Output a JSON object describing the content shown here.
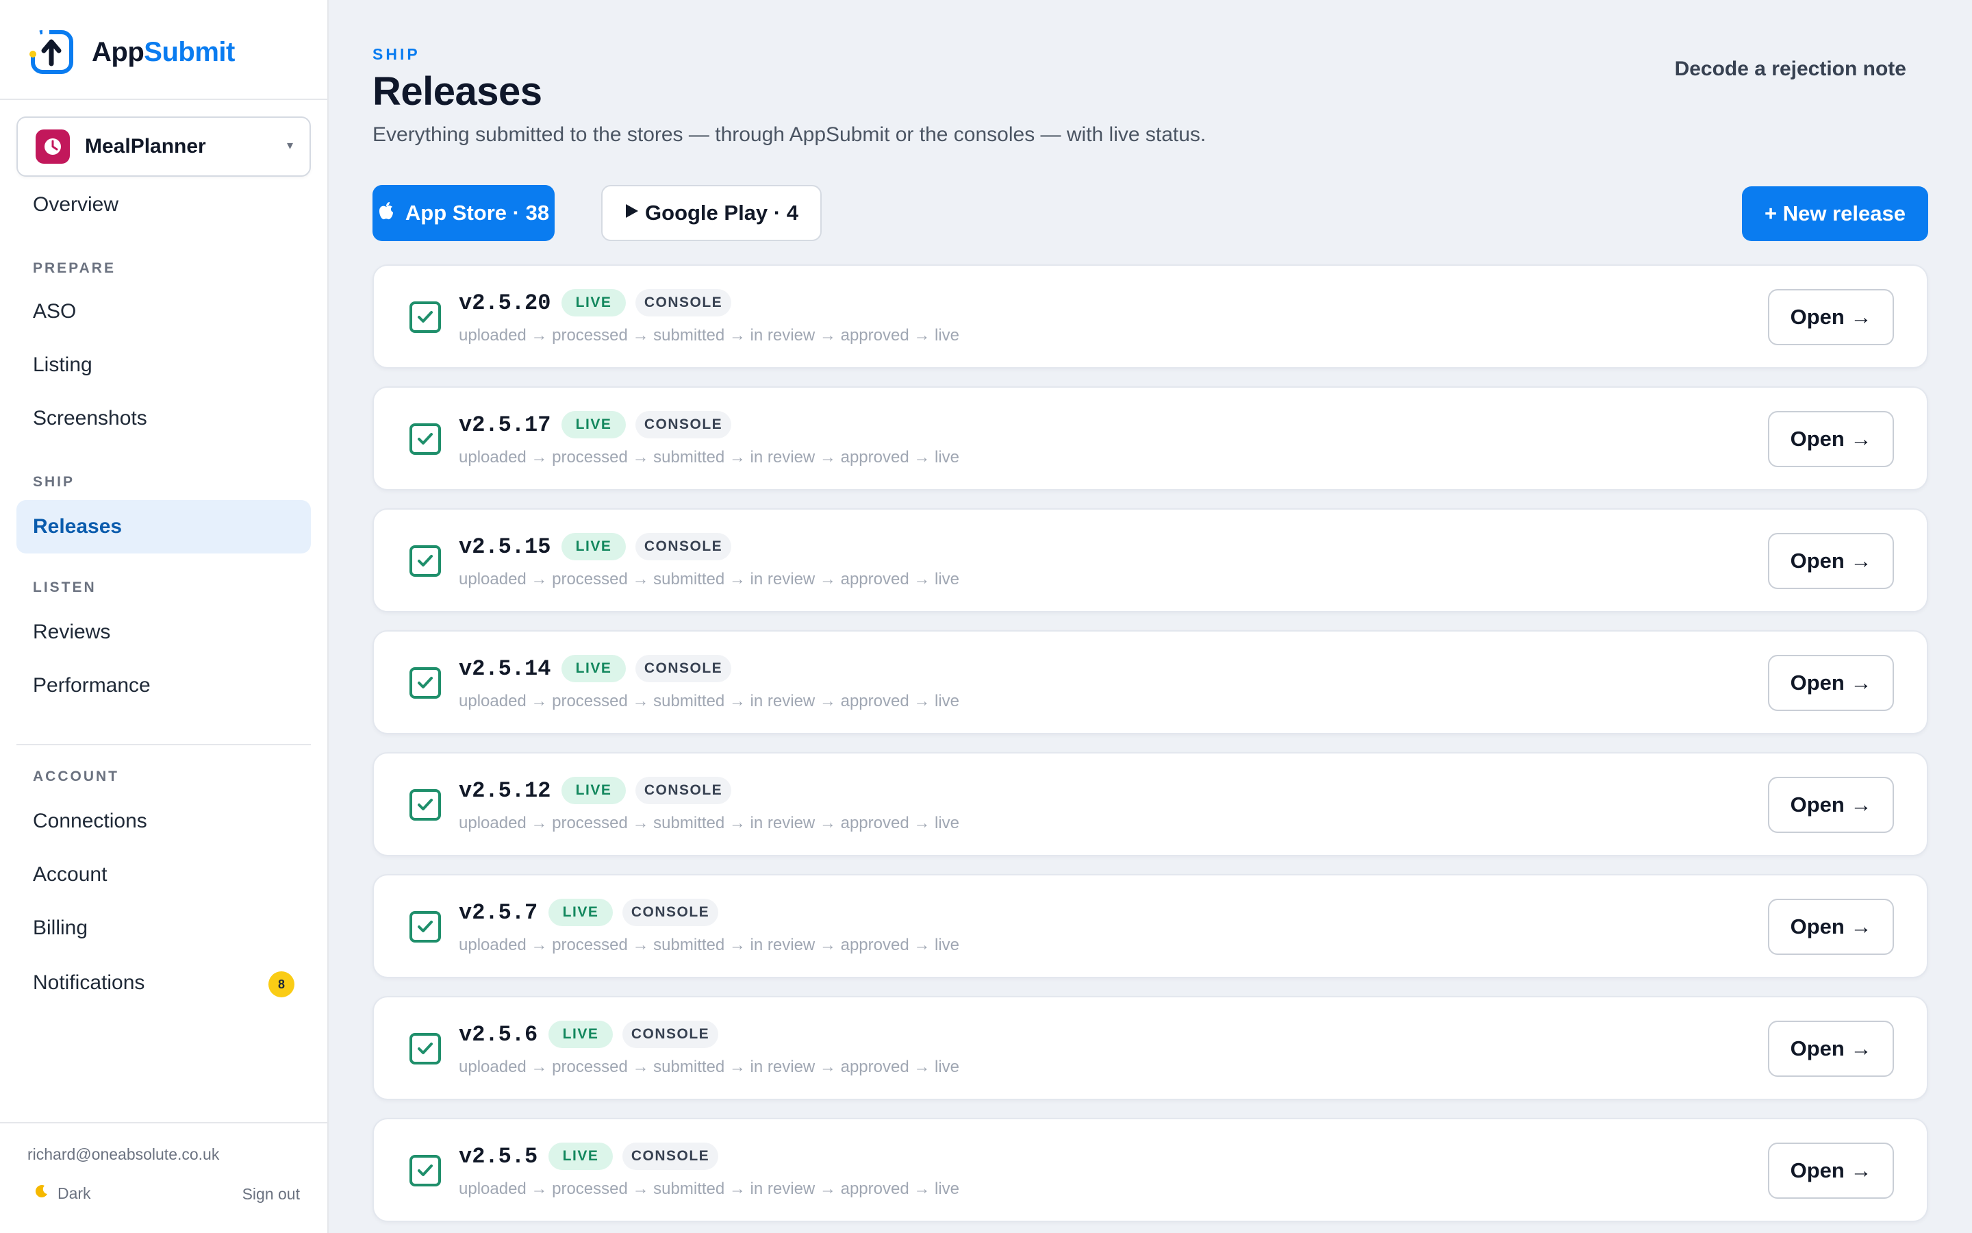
{
  "brand": {
    "name_part1": "App",
    "name_part2": "Submit"
  },
  "app_selector": {
    "name": "MealPlanner",
    "caret": "▾"
  },
  "nav": {
    "overview": "Overview",
    "sections": {
      "prepare": "PREPARE",
      "ship": "SHIP",
      "listen": "LISTEN",
      "account": "ACCOUNT"
    },
    "items": {
      "aso": "ASO",
      "listing": "Listing",
      "screenshots": "Screenshots",
      "releases": "Releases",
      "reviews": "Reviews",
      "performance": "Performance",
      "connections": "Connections",
      "account": "Account",
      "billing": "Billing",
      "notifications": "Notifications"
    },
    "notifications_count": "8"
  },
  "footer": {
    "email": "richard@oneabsolute.co.uk",
    "theme_label": "Dark",
    "sign_out": "Sign out"
  },
  "header": {
    "eyebrow": "SHIP",
    "title": "Releases",
    "subtitle": "Everything submitted to the stores — through AppSubmit or the consoles — with live status.",
    "decode_link": "Decode a rejection note"
  },
  "tabs": {
    "app_store": "App Store · 38",
    "google_play": "Google Play · 4"
  },
  "new_release_label": "+ New release",
  "release_common": {
    "status": "LIVE",
    "source": "CONSOLE",
    "steps": "uploaded → processed → submitted → in review → approved → live",
    "open_label": "Open →"
  },
  "releases": [
    {
      "version": "v2.5.20"
    },
    {
      "version": "v2.5.17"
    },
    {
      "version": "v2.5.15"
    },
    {
      "version": "v2.5.14"
    },
    {
      "version": "v2.5.12"
    },
    {
      "version": "v2.5.7"
    },
    {
      "version": "v2.5.6"
    },
    {
      "version": "v2.5.5"
    }
  ],
  "colors": {
    "accent": "#0a7cf0",
    "live_green": "#12875d",
    "check_green": "#1f8f6b",
    "badge_yellow": "#facc15",
    "app_icon": "#c2185b"
  }
}
